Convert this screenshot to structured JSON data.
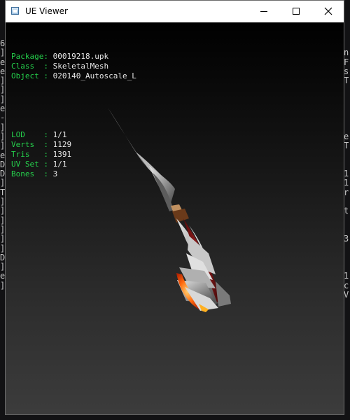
{
  "window": {
    "title": "UE Viewer",
    "controls": [
      "minimize",
      "maximize",
      "close"
    ]
  },
  "object_info": [
    {
      "key": "Package",
      "sep": ": ",
      "value": "00019218.upk"
    },
    {
      "key": "Class  ",
      "sep": ": ",
      "value": "SkeletalMesh"
    },
    {
      "key": "Object ",
      "sep": ": ",
      "value": "020140_Autoscale_L"
    }
  ],
  "mesh_info": [
    {
      "key": "LOD    ",
      "sep": ": ",
      "value": "1/1"
    },
    {
      "key": "Verts  ",
      "sep": ": ",
      "value": "1129"
    },
    {
      "key": "Tris   ",
      "sep": ": ",
      "value": "1391"
    },
    {
      "key": "UV Set ",
      "sep": ": ",
      "value": "1/1"
    },
    {
      "key": "Bones  ",
      "sep": ": ",
      "value": "3"
    }
  ],
  "background_console": {
    "left_column": [
      "6",
      "]",
      "e",
      "e",
      "]",
      "]",
      "]",
      "e",
      "-",
      "]",
      "]",
      "]",
      "e",
      "D",
      "D",
      "]",
      "T",
      "]",
      "]",
      "]",
      "]",
      "]",
      "]",
      "D",
      "]",
      "e",
      "]"
    ],
    "right_column": [
      "",
      "n",
      "F",
      "s",
      "T",
      "",
      "",
      "",
      "",
      "",
      "e",
      "T",
      "",
      "",
      "1",
      "1",
      "r",
      "",
      "t",
      "",
      "",
      "3",
      "",
      "",
      "",
      "1",
      "c",
      "V"
    ]
  },
  "colors": {
    "label_green": "#25d04c",
    "value_white": "#e6e6e6",
    "viewport_top": "#000000",
    "viewport_bottom": "#3c3c3c",
    "blade_red": "#8a1a1a",
    "blade_silver": "#b0b0b0",
    "glow_orange": "#ff6a10"
  },
  "icons": {
    "app_icon": "window-app-icon",
    "minimize": "minimize-icon",
    "maximize": "maximize-icon",
    "close": "close-icon"
  }
}
